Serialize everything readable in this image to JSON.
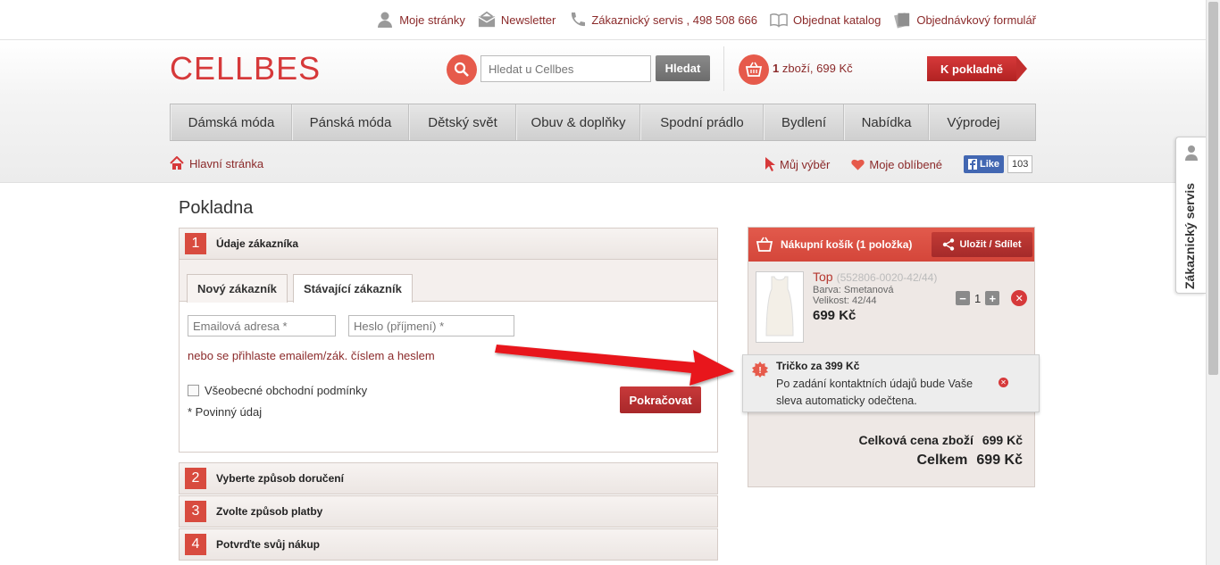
{
  "toplinks": [
    {
      "name": "moje-stranky",
      "label": "Moje stránky"
    },
    {
      "name": "newsletter",
      "label": "Newsletter"
    },
    {
      "name": "zakaznicky-servis",
      "label": "Zákaznický servis , 498 508 666"
    },
    {
      "name": "objednat-katalog",
      "label": "Objednat katalog"
    },
    {
      "name": "objednavkovy-formular",
      "label": "Objednávkový formulář"
    }
  ],
  "logo": "CELLBES",
  "search": {
    "placeholder": "Hledat u Cellbes",
    "button": "Hledat"
  },
  "cart_summary": {
    "count": "1",
    "text": "zboží, 699 Kč"
  },
  "checkout_button": "K pokladně",
  "nav": [
    {
      "label": "Dámská móda",
      "w": 136
    },
    {
      "label": "Pánská móda",
      "w": 131
    },
    {
      "label": "Dětský svět",
      "w": 120
    },
    {
      "label": "Obuv & doplňky",
      "w": 139
    },
    {
      "label": "Spodní prádlo",
      "w": 138
    },
    {
      "label": "Bydlení",
      "w": 90
    },
    {
      "label": "Nabídka",
      "w": 95
    },
    {
      "label": "Výprodej",
      "w": 99
    }
  ],
  "breadcrumb": "Hlavní stránka",
  "sublinks": {
    "my_choice": "Můj výběr",
    "favorites": "Moje oblíbené",
    "like": "Like",
    "like_count": "103"
  },
  "page_title": "Pokladna",
  "steps": [
    {
      "num": "1",
      "label": "Údaje zákazníka"
    },
    {
      "num": "2",
      "label": "Vyberte způsob doručení"
    },
    {
      "num": "3",
      "label": "Zvolte způsob platby"
    },
    {
      "num": "4",
      "label": "Potvrďte svůj nákup"
    }
  ],
  "tabs": {
    "new": "Nový zákazník",
    "existing": "Stávající zákazník"
  },
  "form": {
    "email_placeholder": "Emailová adresa *",
    "password_placeholder": "Heslo (příjmení) *",
    "login_link": "nebo se přihlaste emailem/zák. číslem a heslem",
    "terms": "Všeobecné obchodní podmínky",
    "required": "* Povinný údaj",
    "continue": "Pokračovat"
  },
  "cart": {
    "title": "Nákupní košík (1 položka)",
    "share": "Uložit / Sdílet",
    "product": {
      "name": "Top",
      "code": "(552806-0020-42/44)",
      "color": "Barva: Smetanová",
      "size": "Velikost: 42/44",
      "price": "699 Kč",
      "qty": "1"
    },
    "promo": {
      "title": "Tričko za 399 Kč",
      "text": "Po zadání kontaktních údajů bude Vaše sleva automaticky odečtena."
    },
    "subtotal_label": "Celková cena zboží",
    "subtotal_value": "699 Kč",
    "total_label": "Celkem",
    "total_value": "699 Kč"
  },
  "side_tab": "Zákaznický servis",
  "colors": {
    "brand_red": "#d6393a",
    "link": "#8b2a2a",
    "step_red": "#d84b3f"
  }
}
